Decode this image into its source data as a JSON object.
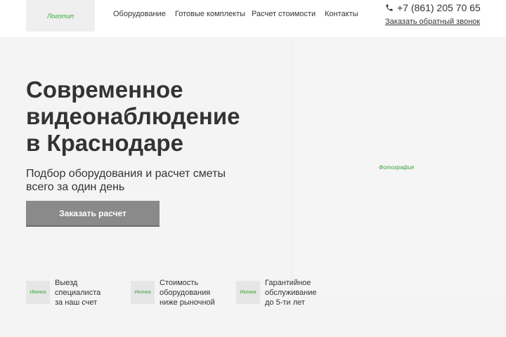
{
  "header": {
    "logo_label": "Логотип",
    "nav": [
      "Оборудование",
      "Готовые комплекты",
      "Расчет стоимости",
      "Контакты"
    ],
    "phone_icon": "phone-icon",
    "phone": "+7 (861) 205 70 65",
    "callback_link": "Заказать обратный звонок"
  },
  "hero": {
    "title_lines": [
      "Современное",
      "видеонаблюдение",
      "в Краснодаре"
    ],
    "subtitle_lines": [
      "Подбор оборудования и расчет сметы",
      "всего за один день"
    ],
    "cta_label": "Заказать расчет",
    "photo_label": "Фотография"
  },
  "features": [
    {
      "icon_label": "Иконка",
      "lines": [
        "Выезд",
        "специалиста",
        "за наш счет"
      ]
    },
    {
      "icon_label": "Иконка",
      "lines": [
        "Стоимость",
        "оборудования",
        "ниже рыночной"
      ]
    },
    {
      "icon_label": "Иконка",
      "lines": [
        "Гарантийное",
        "обслуживание",
        "до 5-ти лет"
      ]
    }
  ],
  "colors": {
    "accent_green": "#3aa53a",
    "button_gray": "#8a8a8a",
    "background": "#f4f4f4"
  }
}
